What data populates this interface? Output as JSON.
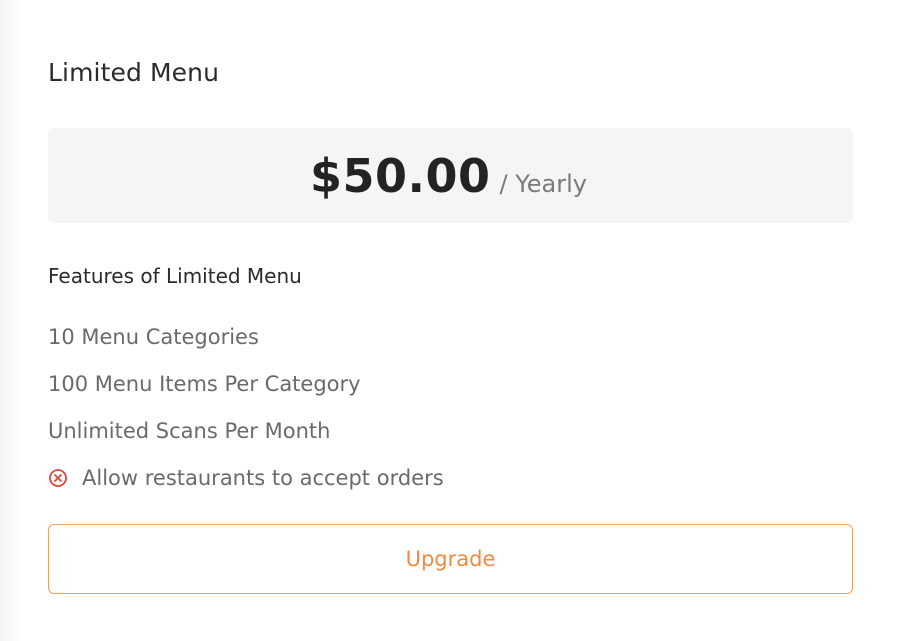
{
  "plan": {
    "title": "Limited Menu",
    "price": "$50.00",
    "period": "/ Yearly"
  },
  "features": {
    "heading": "Features of Limited Menu",
    "items": [
      {
        "label": "10 Menu Categories",
        "icon": null
      },
      {
        "label": "100 Menu Items Per Category",
        "icon": null
      },
      {
        "label": "Unlimited Scans Per Month",
        "icon": null
      },
      {
        "label": "Allow restaurants to accept orders",
        "icon": "x-circle-icon"
      }
    ]
  },
  "actions": {
    "upgrade_label": "Upgrade"
  },
  "colors": {
    "accent": "#ee8a44",
    "price_box_bg": "#f5f5f5",
    "unavailable_icon": "#e0453f"
  }
}
